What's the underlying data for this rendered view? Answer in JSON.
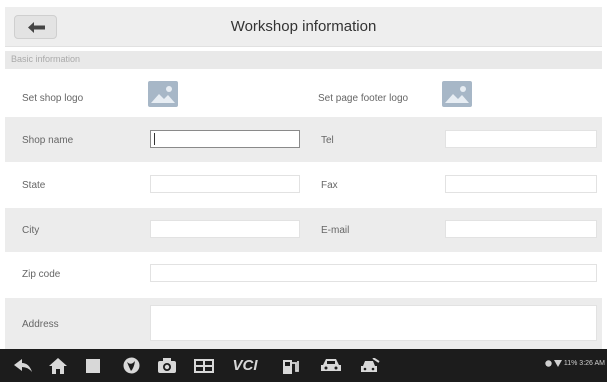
{
  "header": {
    "title": "Workshop information"
  },
  "section": {
    "title": "Basic information"
  },
  "logos": {
    "shop_logo_label": "Set shop logo",
    "footer_logo_label": "Set page footer logo"
  },
  "fields": {
    "shop_name": {
      "label": "Shop name",
      "value": ""
    },
    "tel": {
      "label": "Tel",
      "value": ""
    },
    "state": {
      "label": "State",
      "value": ""
    },
    "fax": {
      "label": "Fax",
      "value": ""
    },
    "city": {
      "label": "City",
      "value": ""
    },
    "email": {
      "label": "E-mail",
      "value": ""
    },
    "zip": {
      "label": "Zip code",
      "value": ""
    },
    "address": {
      "label": "Address",
      "value": ""
    }
  },
  "navbar": {
    "icons": [
      "back-icon",
      "home-icon",
      "recent-apps-icon",
      "browser-icon",
      "camera-icon",
      "display-icon",
      "vci-icon",
      "gas-station-icon",
      "car-icon",
      "car-tools-icon"
    ],
    "vci_label": "VCI",
    "status_text": "11% 3:26 AM"
  },
  "colors": {
    "navbar": "#1c1c1c",
    "row_grey": "#ececec",
    "header": "#eeeeee",
    "icon_blue": "#9fb3c8"
  }
}
